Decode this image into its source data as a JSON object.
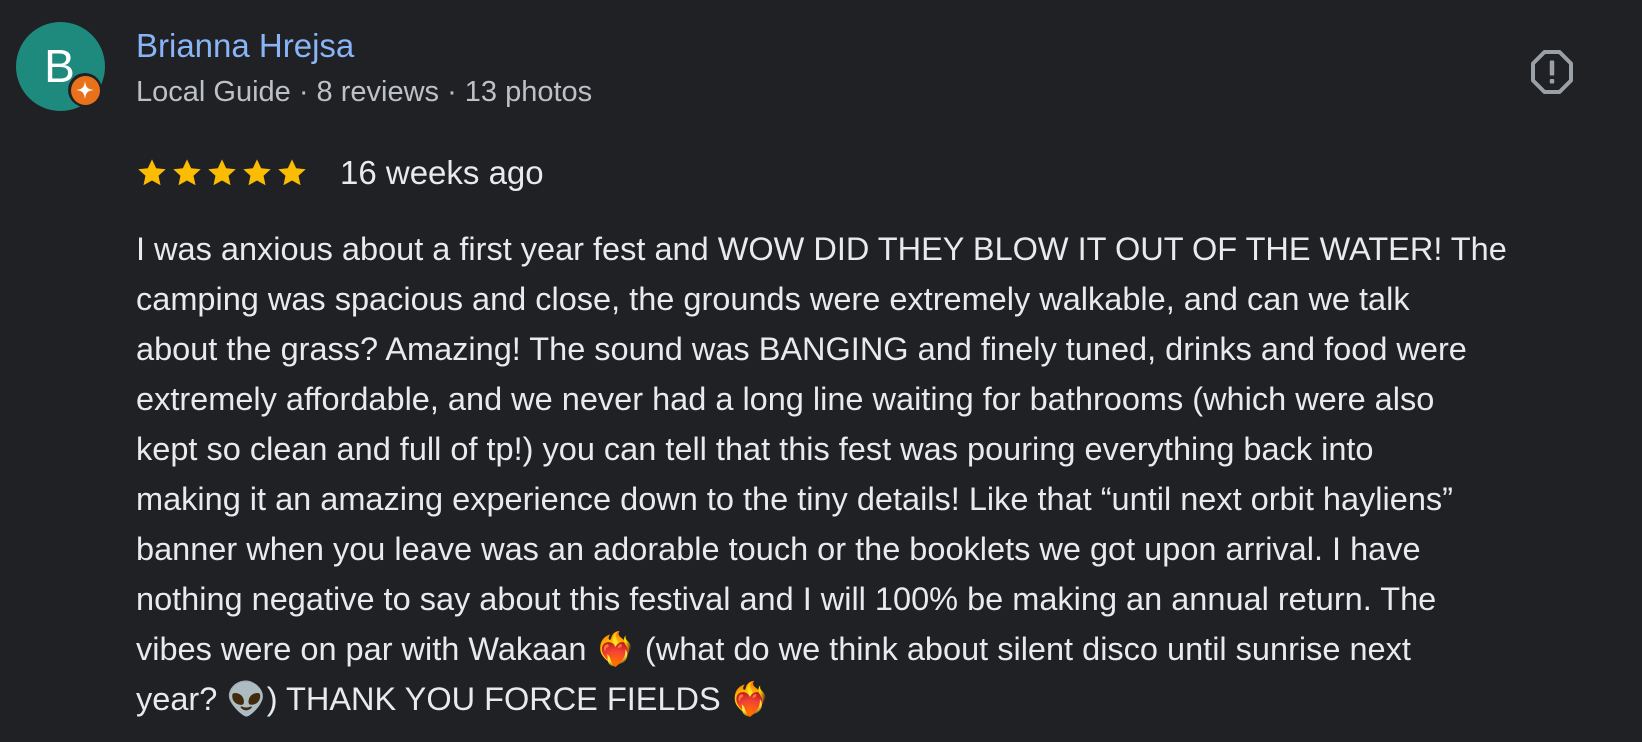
{
  "reviewer": {
    "initial": "B",
    "name": "Brianna Hrejsa",
    "meta": "Local Guide · 8 reviews · 13 photos",
    "avatar_color": "#1e8a7e",
    "badge_icon": "local-guide-star-icon",
    "badge_color": "#e8711c"
  },
  "actions": {
    "report_icon": "report-octagon-icon"
  },
  "review": {
    "rating": 5,
    "max_rating": 5,
    "star_color": "#fbbc04",
    "date": "16 weeks ago",
    "text": "I was anxious about a first year fest and WOW DID THEY BLOW IT OUT OF THE WATER! The\ncamping was spacious and close, the grounds were extremely walkable, and can we talk\nabout the grass? Amazing! The sound was BANGING and finely tuned, drinks and food were\nextremely affordable, and we never had a long line waiting for bathrooms (which were also\nkept so clean and full of tp!) you can tell that this fest was pouring everything back into\nmaking it an amazing experience down to the tiny details! Like that “until next orbit hayliens”\nbanner when you leave was an adorable touch or the booklets we got upon arrival. I have\nnothing negative to say about this festival and I will 100% be making an annual return. The\nvibes were on par with Wakaan ❤️‍🔥 (what do we think about silent disco until sunrise next\nyear? 👽) THANK YOU FORCE FIELDS ❤️‍🔥"
  }
}
